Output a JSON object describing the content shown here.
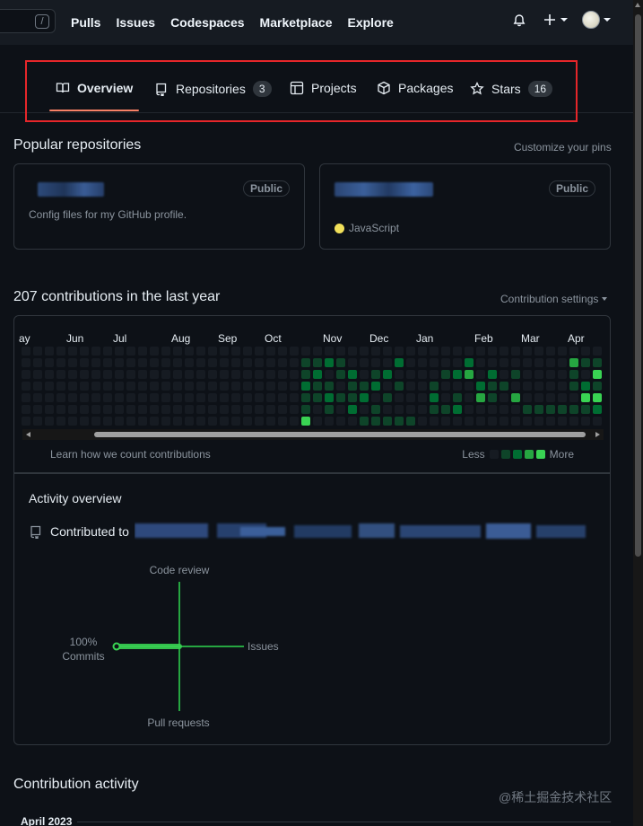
{
  "topbar": {
    "slash_key": "/",
    "nav": [
      "Pulls",
      "Issues",
      "Codespaces",
      "Marketplace",
      "Explore"
    ],
    "icons": [
      "bell-icon",
      "plus-icon",
      "avatar"
    ]
  },
  "profile_tabs": [
    {
      "label": "Overview",
      "icon": "book-icon",
      "active": true
    },
    {
      "label": "Repositories",
      "icon": "repo-icon",
      "count": "3"
    },
    {
      "label": "Projects",
      "icon": "table-icon"
    },
    {
      "label": "Packages",
      "icon": "package-icon"
    },
    {
      "label": "Stars",
      "icon": "star-icon",
      "count": "16"
    }
  ],
  "popular": {
    "title": "Popular repositories",
    "customize": "Customize your pins",
    "cards": [
      {
        "visibility": "Public",
        "description": "Config files for my GitHub profile."
      },
      {
        "visibility": "Public",
        "language": "JavaScript",
        "language_color": "#f1e05a"
      }
    ]
  },
  "contributions": {
    "title": "207 contributions in the last year",
    "settings": "Contribution settings",
    "months": [
      "ay",
      "Jun",
      "Jul",
      "Aug",
      "Sep",
      "Oct",
      "Nov",
      "Dec",
      "Jan",
      "Feb",
      "Mar",
      "Apr"
    ],
    "learn": "Learn how we count contributions",
    "less": "Less",
    "more": "More",
    "colors": [
      "#161b22",
      "#0e4429",
      "#006d32",
      "#26a641",
      "#39d353"
    ]
  },
  "activity": {
    "title": "Activity overview",
    "contributed_to": "Contributed to",
    "axes": {
      "top": "Code review",
      "right": "Issues",
      "bottom": "Pull requests",
      "left_pct": "100%",
      "left": "Commits"
    },
    "commits_pct": 100
  },
  "contribution_activity": {
    "title": "Contribution activity",
    "month": "April 2023"
  },
  "watermark": "@稀土掘金技术社区"
}
